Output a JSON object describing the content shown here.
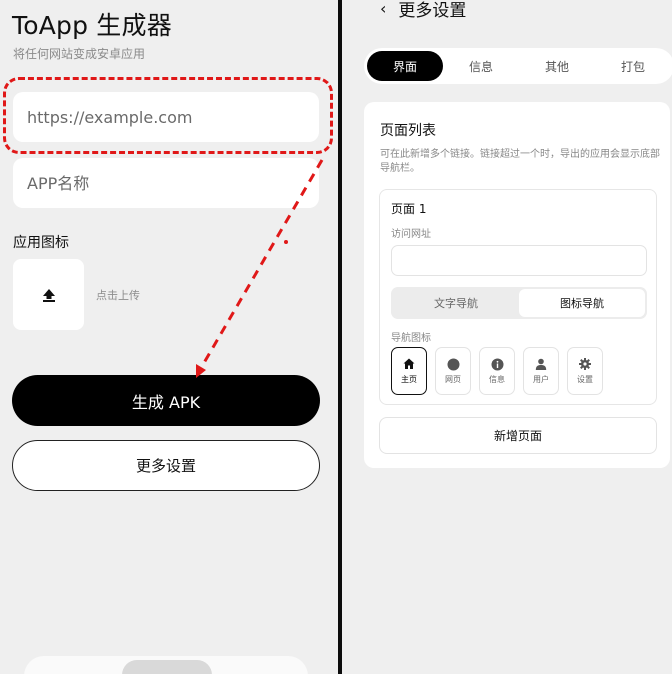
{
  "left": {
    "title": "ToApp 生成器",
    "subtitle": "将任何网站变成安卓应用",
    "url_input": {
      "placeholder": "https://example.com",
      "value": ""
    },
    "name_input": {
      "placeholder": "APP名称",
      "value": ""
    },
    "icon_label": "应用图标",
    "upload_icon": "upload-arrow-icon",
    "upload_hint": "点击上传",
    "generate_button": "生成 APK",
    "more_settings_button": "更多设置",
    "highlight_color": "#e01818"
  },
  "right": {
    "back_icon": "‹",
    "page_title": "更多设置",
    "tabs": [
      {
        "label": "界面",
        "active": true
      },
      {
        "label": "信息",
        "active": false
      },
      {
        "label": "其他",
        "active": false
      },
      {
        "label": "打包",
        "active": false
      }
    ],
    "page_list": {
      "title": "页面列表",
      "description": "可在此新增多个链接。链接超过一个时，导出的应用会显示底部导航栏。",
      "page": {
        "title": "页面 1",
        "url_label": "访问网址",
        "url_value": "",
        "nav_modes": [
          {
            "label": "文字导航",
            "active": false
          },
          {
            "label": "图标导航",
            "active": true
          }
        ],
        "nav_icon_label": "导航图标",
        "nav_icons": [
          {
            "label": "主页",
            "icon": "home-icon",
            "active": true
          },
          {
            "label": "网页",
            "icon": "globe-icon",
            "active": false
          },
          {
            "label": "信息",
            "icon": "info-icon",
            "active": false
          },
          {
            "label": "用户",
            "icon": "user-icon",
            "active": false
          },
          {
            "label": "设置",
            "icon": "gear-icon",
            "active": false
          }
        ]
      },
      "add_page_button": "新增页面"
    }
  }
}
